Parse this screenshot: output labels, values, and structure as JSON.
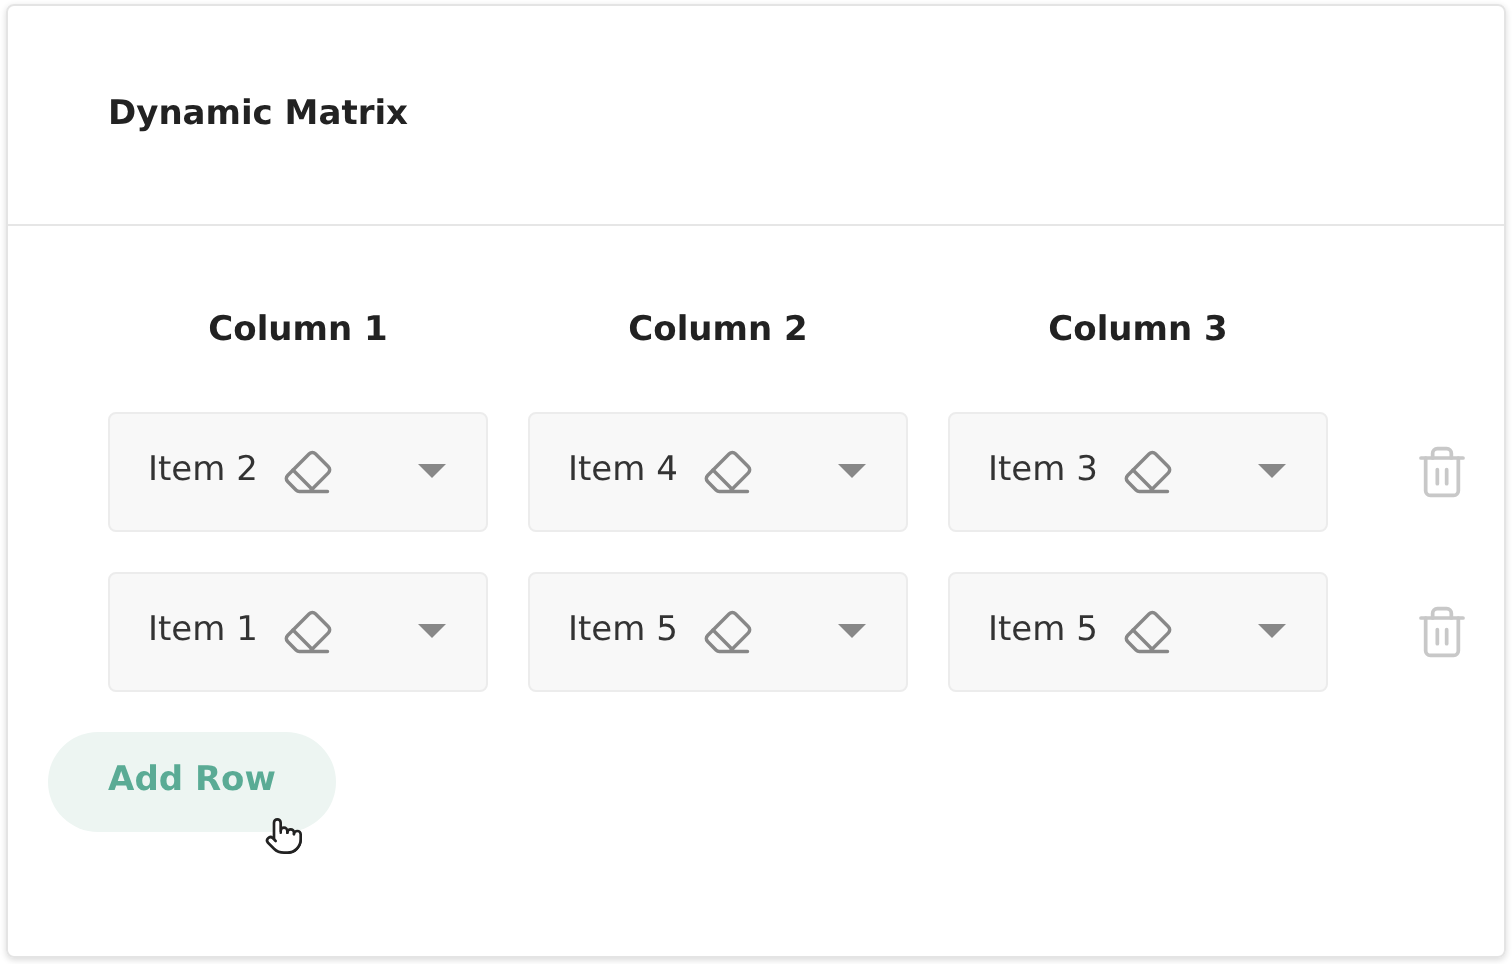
{
  "title": "Dynamic Matrix",
  "columns": [
    "Column 1",
    "Column 2",
    "Column 3"
  ],
  "rows": [
    {
      "cells": [
        "Item 2",
        "Item 4",
        "Item 3"
      ]
    },
    {
      "cells": [
        "Item 1",
        "Item 5",
        "Item 5"
      ]
    }
  ],
  "add_button": "Add Row"
}
